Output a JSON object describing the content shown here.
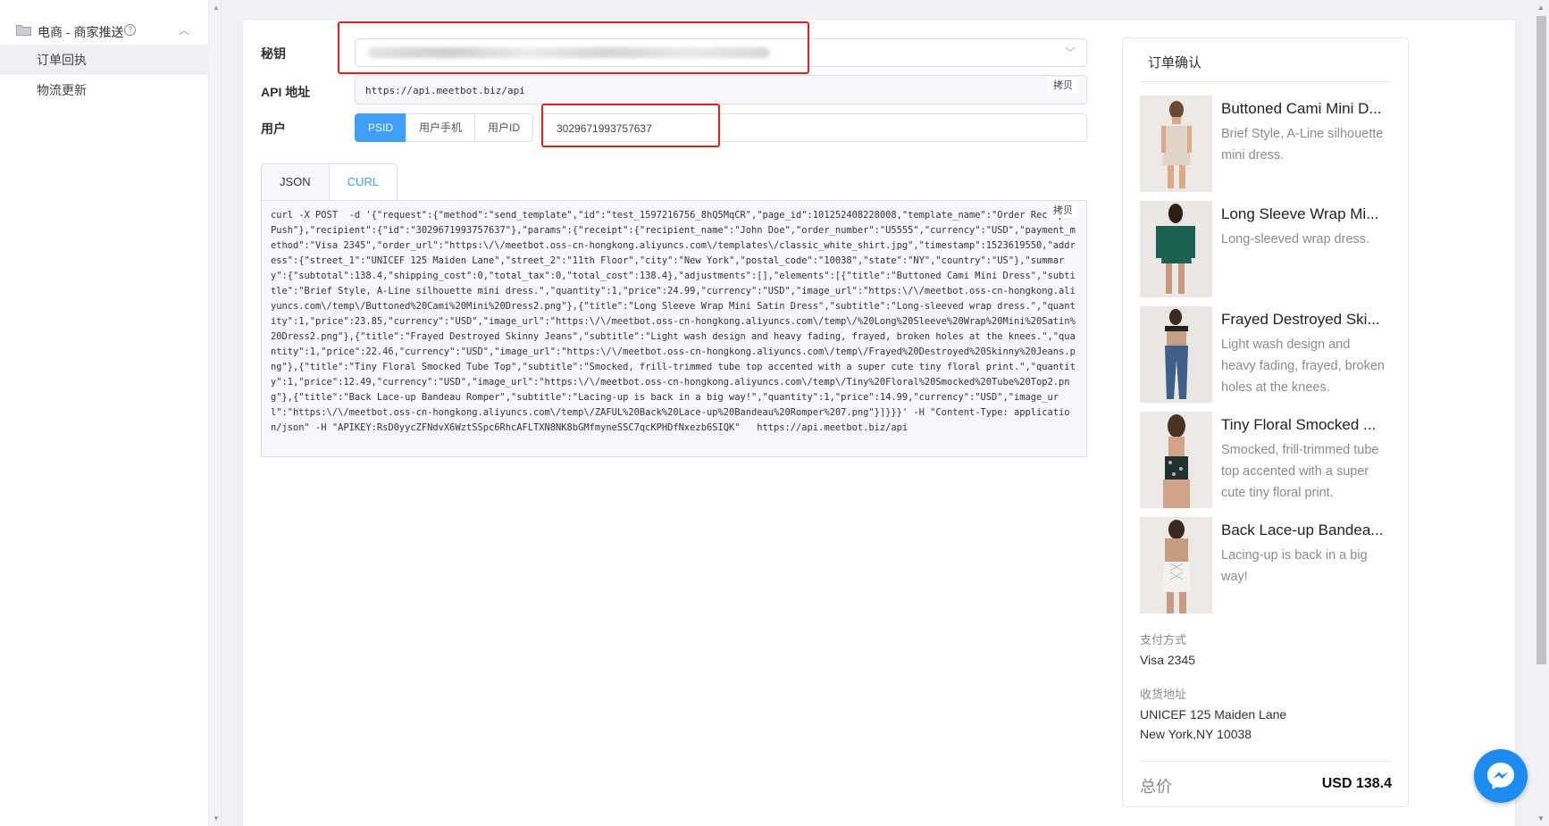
{
  "sidebar": {
    "group_title": "电商 - 商家推送",
    "items": [
      {
        "label": "订单回执",
        "active": true
      },
      {
        "label": "物流更新",
        "active": false
      }
    ]
  },
  "form": {
    "secret_label": "秘钥",
    "api_label": "API 地址",
    "api_url": "https://api.meetbot.biz/api",
    "copy_label": "拷贝",
    "user_label": "用户",
    "user_types": [
      "PSID",
      "用户手机",
      "用户ID"
    ],
    "active_user_type": "PSID",
    "user_value": "3029671993757637"
  },
  "tabs": [
    "JSON",
    "CURL"
  ],
  "active_tab": "CURL",
  "code": "curl -X POST  -d '{\"request\":{\"method\":\"send_template\",\"id\":\"test_1597216756_8hQ5MqCR\",\"page_id\":101252408228008,\"template_name\":\"Order Receipt Push\"},\"recipient\":{\"id\":\"3029671993757637\"},\"params\":{\"receipt\":{\"recipient_name\":\"John Doe\",\"order_number\":\"U5555\",\"currency\":\"USD\",\"payment_method\":\"Visa 2345\",\"order_url\":\"https:\\/\\/meetbot.oss-cn-hongkong.aliyuncs.com\\/templates\\/classic_white_shirt.jpg\",\"timestamp\":1523619550,\"address\":{\"street_1\":\"UNICEF 125 Maiden Lane\",\"street_2\":\"11th Floor\",\"city\":\"New York\",\"postal_code\":\"10038\",\"state\":\"NY\",\"country\":\"US\"},\"summary\":{\"subtotal\":138.4,\"shipping_cost\":0,\"total_tax\":0,\"total_cost\":138.4},\"adjustments\":[],\"elements\":[{\"title\":\"Buttoned Cami Mini Dress\",\"subtitle\":\"Brief Style, A-Line silhouette mini dress.\",\"quantity\":1,\"price\":24.99,\"currency\":\"USD\",\"image_url\":\"https:\\/\\/meetbot.oss-cn-hongkong.aliyuncs.com\\/temp\\/Buttoned%20Cami%20Mini%20Dress2.png\"},{\"title\":\"Long Sleeve Wrap Mini Satin Dress\",\"subtitle\":\"Long-sleeved wrap dress.\",\"quantity\":1,\"price\":23.85,\"currency\":\"USD\",\"image_url\":\"https:\\/\\/meetbot.oss-cn-hongkong.aliyuncs.com\\/temp\\/%20Long%20Sleeve%20Wrap%20Mini%20Satin%20Dress2.png\"},{\"title\":\"Frayed Destroyed Skinny Jeans\",\"subtitle\":\"Light wash design and heavy fading, frayed, broken holes at the knees.\",\"quantity\":1,\"price\":22.46,\"currency\":\"USD\",\"image_url\":\"https:\\/\\/meetbot.oss-cn-hongkong.aliyuncs.com\\/temp\\/Frayed%20Destroyed%20Skinny%20Jeans.png\"},{\"title\":\"Tiny Floral Smocked Tube Top\",\"subtitle\":\"Smocked, frill-trimmed tube top accented with a super cute tiny floral print.\",\"quantity\":1,\"price\":12.49,\"currency\":\"USD\",\"image_url\":\"https:\\/\\/meetbot.oss-cn-hongkong.aliyuncs.com\\/temp\\/Tiny%20Floral%20Smocked%20Tube%20Top2.png\"},{\"title\":\"Back Lace-up Bandeau Romper\",\"subtitle\":\"Lacing-up is back in a big way!\",\"quantity\":1,\"price\":14.99,\"currency\":\"USD\",\"image_url\":\"https:\\/\\/meetbot.oss-cn-hongkong.aliyuncs.com\\/temp\\/ZAFUL%20Back%20Lace-up%20Bandeau%20Romper%207.png\"}]}}}' -H \"Content-Type: application/json\" -H \"APIKEY:RsD0yycZFNdvX6WztSSpc6RhcAFLTXN8NK8bGMfmyneSSC7qcKPHDfNxezb6SIQK\"   https://api.meetbot.biz/api",
  "preview": {
    "title": "订单确认",
    "items": [
      {
        "name": "Buttoned Cami Mini D...",
        "desc": "Brief Style, A-Line silhouette mini dress."
      },
      {
        "name": "Long Sleeve Wrap Mi...",
        "desc": "Long-sleeved wrap dress."
      },
      {
        "name": "Frayed Destroyed Ski...",
        "desc": "Light wash design and heavy fading, frayed, broken holes at the knees."
      },
      {
        "name": "Tiny Floral Smocked ...",
        "desc": "Smocked, frill-trimmed tube top accented with a super cute tiny floral print."
      },
      {
        "name": "Back Lace-up Bandea...",
        "desc": "Lacing-up is back in a big way!"
      }
    ],
    "payment_label": "支付方式",
    "payment_value": "Visa 2345",
    "address_label": "收货地址",
    "address_line1": "UNICEF 125 Maiden Lane",
    "address_line2": "New York,NY 10038",
    "total_label": "总价",
    "total_value": "USD 138.4"
  },
  "colors": {
    "primary": "#409eff",
    "highlight": "#e02020",
    "messenger": "#1d8cf2"
  },
  "icons": [
    "folder-icon",
    "help-icon",
    "chevron-up-icon",
    "chevron-down-icon",
    "messenger-icon"
  ]
}
